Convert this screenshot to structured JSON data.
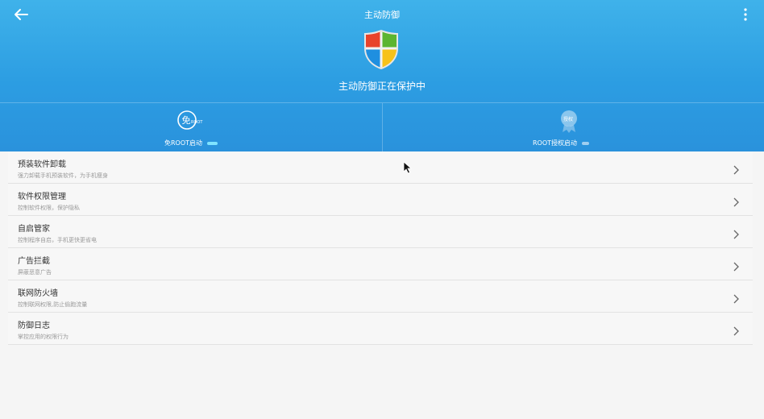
{
  "header": {
    "title": "主动防御",
    "status_text": "主动防御正在保护中",
    "bg_color": "#2c9de2"
  },
  "modes": [
    {
      "icon_text": "免",
      "icon_sub": "ROOT",
      "label": "免ROOT启动"
    },
    {
      "icon_text": "授权",
      "label": "ROOT授权启动"
    }
  ],
  "items": [
    {
      "title": "预装软件卸载",
      "subtitle": "强力卸载手机预装软件，为手机瘦身"
    },
    {
      "title": "软件权限管理",
      "subtitle": "控制软件权限，保护隐私"
    },
    {
      "title": "自启管家",
      "subtitle": "控制程序自启，手机更快更省电"
    },
    {
      "title": "广告拦截",
      "subtitle": "屏蔽恶意广告"
    },
    {
      "title": "联网防火墙",
      "subtitle": "控制联网权限,防止偷跑流量"
    },
    {
      "title": "防御日志",
      "subtitle": "掌控应用的权限行为"
    }
  ]
}
